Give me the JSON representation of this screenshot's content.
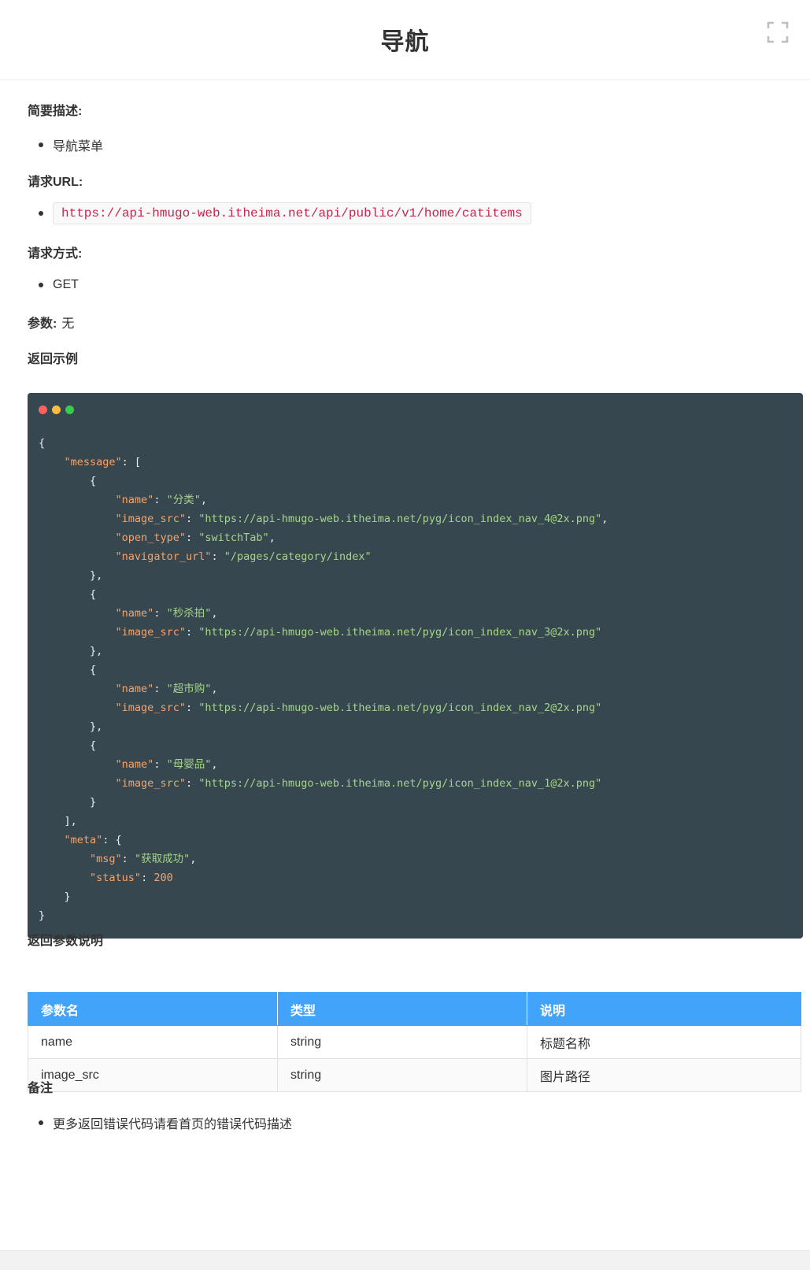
{
  "header": {
    "title": "导航",
    "fullscreen_icon": "fullscreen-icon"
  },
  "sections": {
    "summary_label": "简要描述:",
    "summary_items": [
      "导航菜单"
    ],
    "url_label": "请求URL:",
    "url_value": "https://api-hmugo-web.itheima.net/api/public/v1/home/catitems",
    "method_label": "请求方式:",
    "method_value": "GET",
    "params_label": "参数:",
    "params_value": "无",
    "response_example_label": "返回示例",
    "response_params_label": "返回参数说明",
    "notes_label": "备注",
    "notes_items": [
      "更多返回错误代码请看首页的错误代码描述"
    ]
  },
  "code_block": {
    "window_dot_colors": [
      "#fc625d",
      "#fdbc40",
      "#35cd4b"
    ],
    "lines": [
      [
        {
          "t": "pun",
          "v": "{"
        }
      ],
      [
        {
          "t": "pun",
          "v": "    "
        },
        {
          "t": "key",
          "v": "\"message\""
        },
        {
          "t": "pun",
          "v": ": ["
        }
      ],
      [
        {
          "t": "pun",
          "v": "        {"
        }
      ],
      [
        {
          "t": "pun",
          "v": "            "
        },
        {
          "t": "key",
          "v": "\"name\""
        },
        {
          "t": "pun",
          "v": ": "
        },
        {
          "t": "str",
          "v": "\"分类\""
        },
        {
          "t": "pun",
          "v": ","
        }
      ],
      [
        {
          "t": "pun",
          "v": "            "
        },
        {
          "t": "key",
          "v": "\"image_src\""
        },
        {
          "t": "pun",
          "v": ": "
        },
        {
          "t": "str",
          "v": "\"https://api-hmugo-web.itheima.net/pyg/icon_index_nav_4@2x.png\""
        },
        {
          "t": "pun",
          "v": ","
        }
      ],
      [
        {
          "t": "pun",
          "v": "            "
        },
        {
          "t": "key",
          "v": "\"open_type\""
        },
        {
          "t": "pun",
          "v": ": "
        },
        {
          "t": "str",
          "v": "\"switchTab\""
        },
        {
          "t": "pun",
          "v": ","
        }
      ],
      [
        {
          "t": "pun",
          "v": "            "
        },
        {
          "t": "key",
          "v": "\"navigator_url\""
        },
        {
          "t": "pun",
          "v": ": "
        },
        {
          "t": "str",
          "v": "\"/pages/category/index\""
        }
      ],
      [
        {
          "t": "pun",
          "v": "        },"
        }
      ],
      [
        {
          "t": "pun",
          "v": "        {"
        }
      ],
      [
        {
          "t": "pun",
          "v": "            "
        },
        {
          "t": "key",
          "v": "\"name\""
        },
        {
          "t": "pun",
          "v": ": "
        },
        {
          "t": "str",
          "v": "\"秒杀拍\""
        },
        {
          "t": "pun",
          "v": ","
        }
      ],
      [
        {
          "t": "pun",
          "v": "            "
        },
        {
          "t": "key",
          "v": "\"image_src\""
        },
        {
          "t": "pun",
          "v": ": "
        },
        {
          "t": "str",
          "v": "\"https://api-hmugo-web.itheima.net/pyg/icon_index_nav_3@2x.png\""
        }
      ],
      [
        {
          "t": "pun",
          "v": "        },"
        }
      ],
      [
        {
          "t": "pun",
          "v": "        {"
        }
      ],
      [
        {
          "t": "pun",
          "v": "            "
        },
        {
          "t": "key",
          "v": "\"name\""
        },
        {
          "t": "pun",
          "v": ": "
        },
        {
          "t": "str",
          "v": "\"超市购\""
        },
        {
          "t": "pun",
          "v": ","
        }
      ],
      [
        {
          "t": "pun",
          "v": "            "
        },
        {
          "t": "key",
          "v": "\"image_src\""
        },
        {
          "t": "pun",
          "v": ": "
        },
        {
          "t": "str",
          "v": "\"https://api-hmugo-web.itheima.net/pyg/icon_index_nav_2@2x.png\""
        }
      ],
      [
        {
          "t": "pun",
          "v": "        },"
        }
      ],
      [
        {
          "t": "pun",
          "v": "        {"
        }
      ],
      [
        {
          "t": "pun",
          "v": "            "
        },
        {
          "t": "key",
          "v": "\"name\""
        },
        {
          "t": "pun",
          "v": ": "
        },
        {
          "t": "str",
          "v": "\"母婴品\""
        },
        {
          "t": "pun",
          "v": ","
        }
      ],
      [
        {
          "t": "pun",
          "v": "            "
        },
        {
          "t": "key",
          "v": "\"image_src\""
        },
        {
          "t": "pun",
          "v": ": "
        },
        {
          "t": "str",
          "v": "\"https://api-hmugo-web.itheima.net/pyg/icon_index_nav_1@2x.png\""
        }
      ],
      [
        {
          "t": "pun",
          "v": "        }"
        }
      ],
      [
        {
          "t": "pun",
          "v": "    ],"
        }
      ],
      [
        {
          "t": "pun",
          "v": "    "
        },
        {
          "t": "key",
          "v": "\"meta\""
        },
        {
          "t": "pun",
          "v": ": {"
        }
      ],
      [
        {
          "t": "pun",
          "v": "        "
        },
        {
          "t": "key",
          "v": "\"msg\""
        },
        {
          "t": "pun",
          "v": ": "
        },
        {
          "t": "str",
          "v": "\"获取成功\""
        },
        {
          "t": "pun",
          "v": ","
        }
      ],
      [
        {
          "t": "pun",
          "v": "        "
        },
        {
          "t": "key",
          "v": "\"status\""
        },
        {
          "t": "pun",
          "v": ": "
        },
        {
          "t": "num",
          "v": "200"
        }
      ],
      [
        {
          "t": "pun",
          "v": "    }"
        }
      ],
      [
        {
          "t": "pun",
          "v": "}"
        }
      ]
    ]
  },
  "table": {
    "headers": [
      "参数名",
      "类型",
      "说明"
    ],
    "rows": [
      [
        "name",
        "string",
        "标题名称"
      ],
      [
        "image_src",
        "string",
        "图片路径"
      ]
    ]
  },
  "colors": {
    "table_header_bg": "#42a3fb",
    "code_bg": "#37474f",
    "url_text": "#c7254e"
  }
}
